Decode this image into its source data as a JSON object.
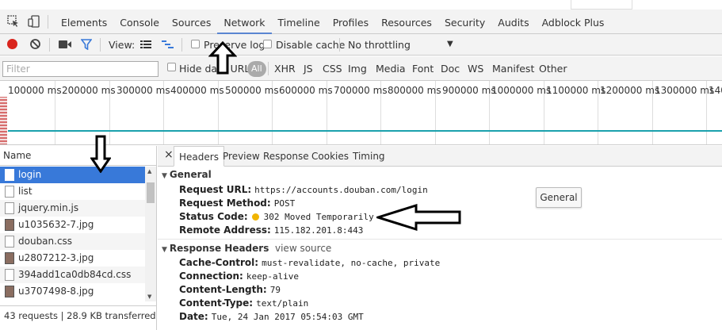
{
  "tabs": [
    "Elements",
    "Console",
    "Sources",
    "Network",
    "Timeline",
    "Profiles",
    "Resources",
    "Security",
    "Audits",
    "Adblock Plus"
  ],
  "active_tab": "Network",
  "toolbar": {
    "view_label": "View:",
    "preserve_log": "Preserve log",
    "disable_cache": "Disable cache",
    "throttling": "No throttling",
    "throttling_arrow": "▼"
  },
  "filter": {
    "placeholder": "Filter",
    "hide_data_urls": "Hide data URLs",
    "all": "All",
    "types": [
      "XHR",
      "JS",
      "CSS",
      "Img",
      "Media",
      "Font",
      "Doc",
      "WS",
      "Manifest",
      "Other"
    ]
  },
  "timeline": {
    "ticks": [
      "100000 ms",
      "200000 ms",
      "300000 ms",
      "400000 ms",
      "500000 ms",
      "600000 ms",
      "700000 ms",
      "800000 ms",
      "900000 ms",
      "1000000 ms",
      "1100000 ms",
      "1200000 ms",
      "1300000 ms",
      "140"
    ]
  },
  "requests": {
    "column_name": "Name",
    "items": [
      "login",
      "list",
      "jquery.min.js",
      "u1035632-7.jpg",
      "douban.css",
      "u2807212-3.jpg",
      "394add1ca0db84cd.css",
      "u3707498-8.jpg"
    ],
    "selected": "login",
    "status_text": "43 requests | 28.9 KB transferred"
  },
  "details": {
    "close": "×",
    "tabs": [
      "Headers",
      "Preview",
      "Response",
      "Cookies",
      "Timing"
    ],
    "active_tab": "Headers",
    "general": {
      "title": "General",
      "request_url_label": "Request URL:",
      "request_url": "https://accounts.douban.com/login",
      "request_method_label": "Request Method:",
      "request_method": "POST",
      "status_code_label": "Status Code:",
      "status_code": "302 Moved Temporarily",
      "remote_address_label": "Remote Address:",
      "remote_address": "115.182.201.8:443",
      "tooltip": "General"
    },
    "response_headers": {
      "title": "Response Headers",
      "view_source": "view source",
      "cache_control_label": "Cache-Control:",
      "cache_control": "must-revalidate, no-cache, private",
      "connection_label": "Connection:",
      "connection": "keep-alive",
      "content_length_label": "Content-Length:",
      "content_length": "79",
      "content_type_label": "Content-Type:",
      "content_type": "text/plain",
      "date_label": "Date:",
      "date": "Tue, 24 Jan 2017 05:54:03 GMT"
    }
  },
  "colors": {
    "accent": "#3879d9",
    "record": "#d9251d",
    "timeline_line": "#1ba1ad",
    "status_dot": "#f0b400"
  }
}
